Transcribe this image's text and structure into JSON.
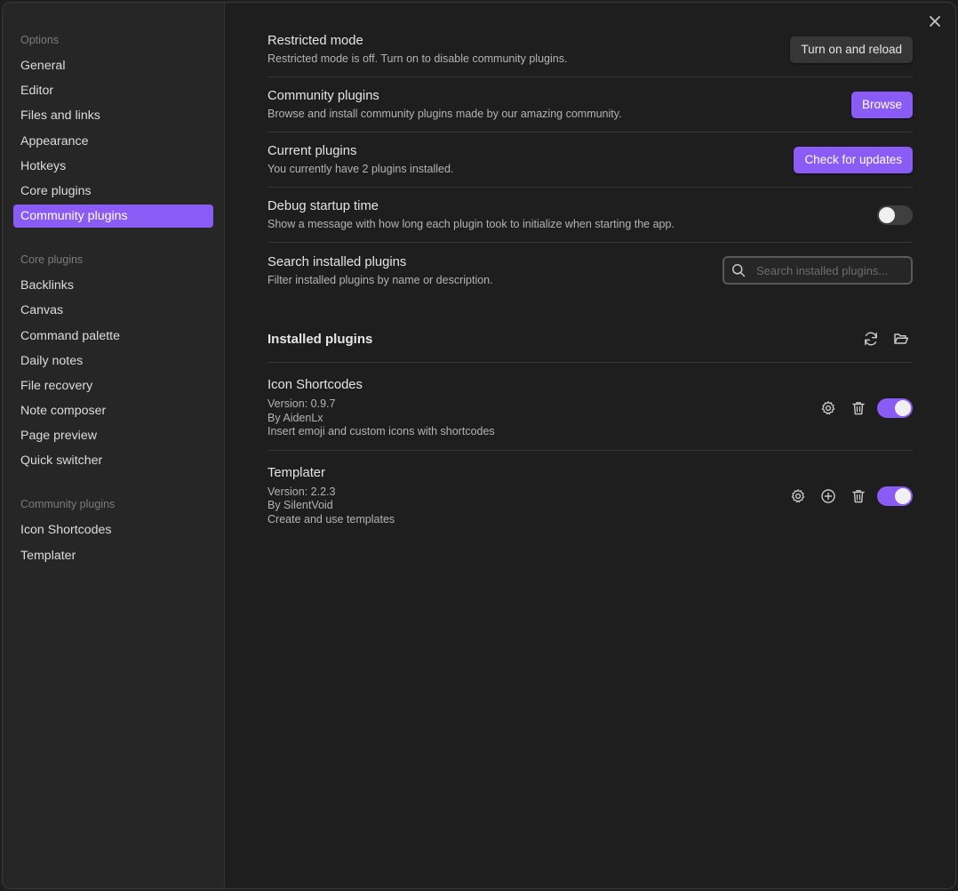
{
  "sidebar": {
    "groups": [
      {
        "heading": "Options",
        "items": [
          "General",
          "Editor",
          "Files and links",
          "Appearance",
          "Hotkeys",
          "Core plugins",
          "Community plugins"
        ]
      },
      {
        "heading": "Core plugins",
        "items": [
          "Backlinks",
          "Canvas",
          "Command palette",
          "Daily notes",
          "File recovery",
          "Note composer",
          "Page preview",
          "Quick switcher"
        ]
      },
      {
        "heading": "Community plugins",
        "items": [
          "Icon Shortcodes",
          "Templater"
        ]
      }
    ],
    "active_item": "Community plugins"
  },
  "settings": {
    "restricted": {
      "title": "Restricted mode",
      "desc": "Restricted mode is off. Turn on to disable community plugins.",
      "button": "Turn on and reload"
    },
    "community": {
      "title": "Community plugins",
      "desc": "Browse and install community plugins made by our amazing community.",
      "button": "Browse"
    },
    "current": {
      "title": "Current plugins",
      "desc": "You currently have 2 plugins installed.",
      "button": "Check for updates"
    },
    "debug": {
      "title": "Debug startup time",
      "desc": "Show a message with how long each plugin took to initialize when starting the app.",
      "enabled": false
    },
    "search": {
      "title": "Search installed plugins",
      "desc": "Filter installed plugins by name or description.",
      "placeholder": "Search installed plugins..."
    }
  },
  "installed": {
    "title": "Installed plugins",
    "plugins": [
      {
        "name": "Icon Shortcodes",
        "version": "Version: 0.9.7",
        "author": "By AidenLx",
        "desc": "Insert emoji and custom icons with shortcodes",
        "enabled": true
      },
      {
        "name": "Templater",
        "version": "Version: 2.2.3",
        "author": "By SilentVoid",
        "desc": "Create and use templates",
        "enabled": true
      }
    ]
  },
  "icons": {
    "close": "x-icon",
    "search": "search-icon",
    "reload": "refresh-icon",
    "folder": "folder-open-icon",
    "settings": "gear-icon",
    "hotkeys": "plus-circle-icon",
    "delete": "trash-icon"
  },
  "colors": {
    "accent": "#8a5cf5",
    "background": "#1e1e1e",
    "sidebar": "#262626"
  }
}
